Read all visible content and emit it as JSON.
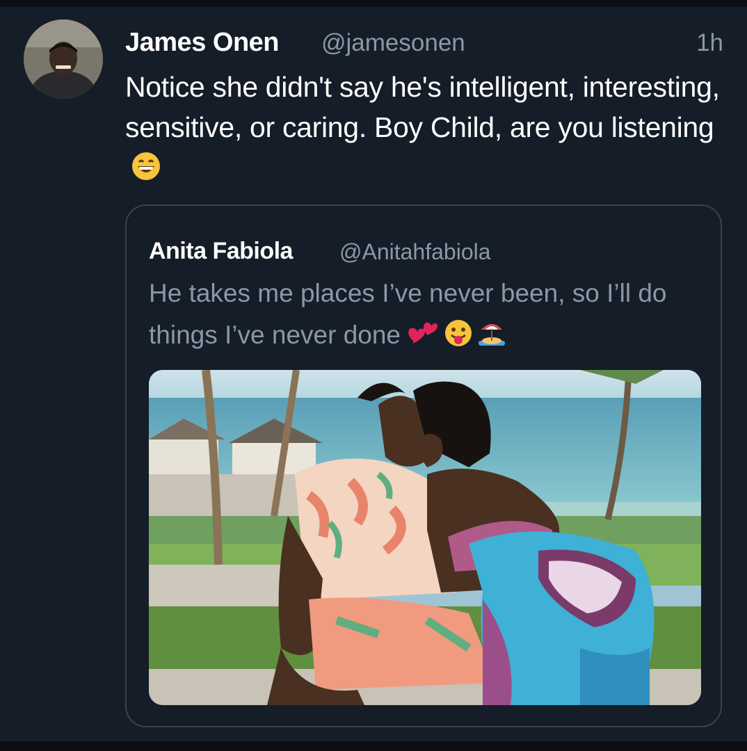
{
  "tweet": {
    "author_name": "James Onen",
    "author_handle": "@jamesonen",
    "timestamp": "1h",
    "text": "Notice she didn't say he's intelligent, interesting, sensitive, or caring. Boy Child, are you listening",
    "emoji": "grinning-face-with-smiling-eyes"
  },
  "quoted_tweet": {
    "author_name": "Anita Fabiola",
    "author_handle": "@Anitahfabiola",
    "text": "He takes me places I’ve never been, so I’ll do things I’ve never done",
    "emojis": [
      "two-hearts",
      "face-with-tongue",
      "desert-island"
    ],
    "photo": "couple-on-beach-photo"
  },
  "colors": {
    "background": "#151d28",
    "primary_text": "#ffffff",
    "secondary_text": "#8b98a5",
    "border": "#38444d"
  }
}
